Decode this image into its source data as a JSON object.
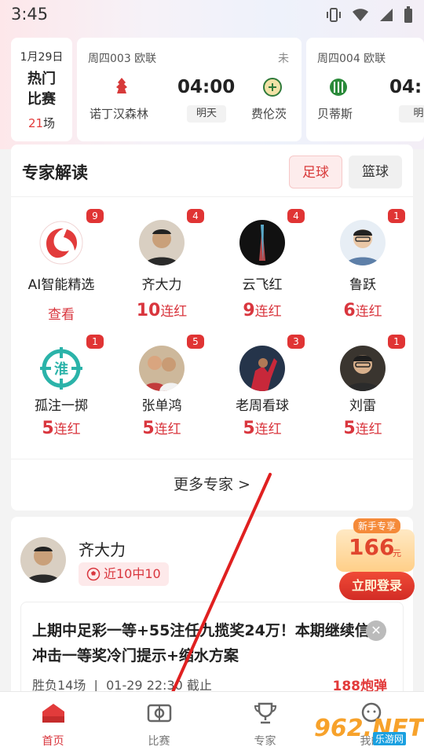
{
  "status_bar": {
    "time": "3:45"
  },
  "match_strip": {
    "date_card": {
      "date": "1月29日",
      "label": "热门比赛",
      "count": "21",
      "count_unit": "场"
    },
    "matches": [
      {
        "league": "周四003 欧联",
        "status": "未",
        "home": "诺丁汉森林",
        "away": "费伦茨",
        "time": "04:00",
        "day": "明天"
      },
      {
        "league": "周四004 欧联",
        "status": "",
        "home": "贝蒂斯",
        "away": "",
        "time": "04:",
        "day": "明"
      }
    ]
  },
  "expert_section": {
    "title": "专家解读",
    "tabs": [
      "足球",
      "篮球"
    ],
    "experts": [
      {
        "name": "AI智能精选",
        "badge": "9",
        "streak": "",
        "streak_unit": "",
        "link": "查看"
      },
      {
        "name": "齐大力",
        "badge": "4",
        "streak": "10",
        "streak_unit": "连红"
      },
      {
        "name": "云飞红",
        "badge": "4",
        "streak": "9",
        "streak_unit": "连红"
      },
      {
        "name": "鲁跃",
        "badge": "1",
        "streak": "6",
        "streak_unit": "连红"
      },
      {
        "name": "孤注一掷",
        "badge": "1",
        "streak": "5",
        "streak_unit": "连红"
      },
      {
        "name": "张单鸿",
        "badge": "5",
        "streak": "5",
        "streak_unit": "连红"
      },
      {
        "name": "老周看球",
        "badge": "3",
        "streak": "5",
        "streak_unit": "连红"
      },
      {
        "name": "刘雷",
        "badge": "1",
        "streak": "5",
        "streak_unit": "连红"
      }
    ],
    "more_label": "更多专家 >"
  },
  "article": {
    "author": "齐大力",
    "record": "近10中10",
    "text": "上期中足彩一等+55注任九揽奖24万！本期继续信心冲击一等奖冷门提示+缩水方案",
    "meta_games": "胜负14场",
    "meta_deadline": "01-29 22:30 截止",
    "price": "188炮弹"
  },
  "promo": {
    "tag": "新手专享",
    "amount": "166",
    "unit": "元",
    "button": "立即登录"
  },
  "bottom_nav": {
    "items": [
      {
        "label": "首页",
        "icon": "home-icon"
      },
      {
        "label": "比赛",
        "icon": "match-icon"
      },
      {
        "label": "专家",
        "icon": "trophy-icon"
      },
      {
        "label": "我的",
        "icon": "profile-icon"
      }
    ]
  },
  "watermark": {
    "text": "962.NET",
    "sub": "乐游网"
  },
  "colors": {
    "accent": "#d9363e",
    "badge": "#e03434"
  }
}
